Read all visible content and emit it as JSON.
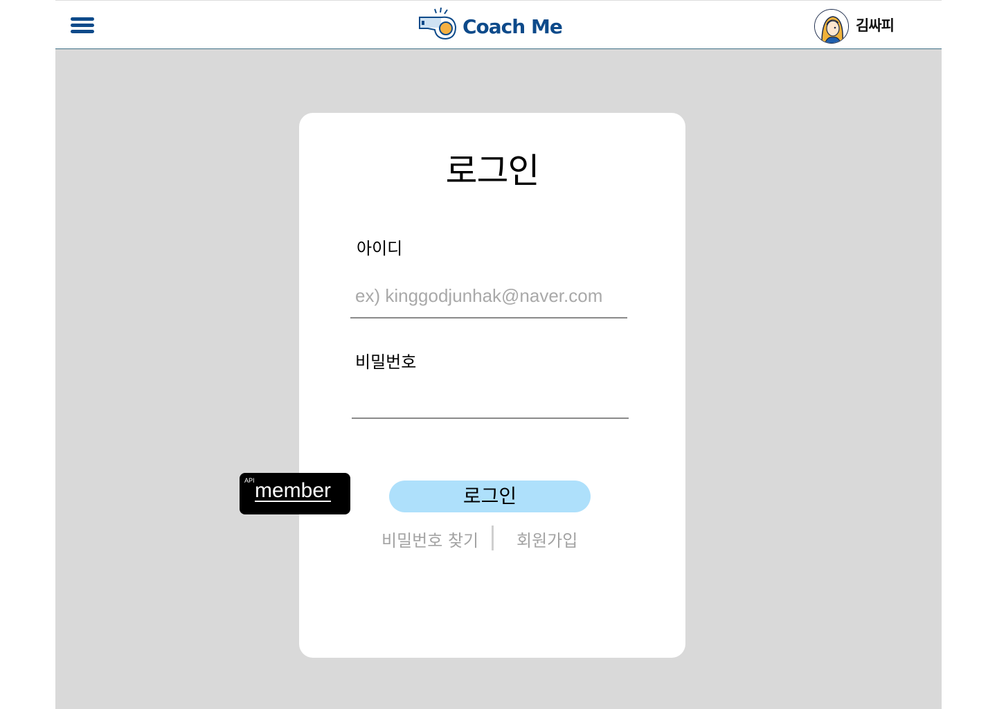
{
  "header": {
    "logo_text": "Coach Me",
    "user_name": "김싸피"
  },
  "login": {
    "title": "로그인",
    "id_label": "아이디",
    "id_placeholder": "ex) kinggodjunhak@naver.com",
    "id_value": "",
    "password_label": "비밀번호",
    "password_value": "",
    "submit_label": "로그인",
    "find_password_label": "비밀번호 찾기",
    "signup_label": "회원가입"
  },
  "api_badge": {
    "tag": "API",
    "name": "member"
  },
  "colors": {
    "brand": "#0d4a8a",
    "button": "#aee0fb",
    "background": "#d9d9d9",
    "link": "#a3a3a3"
  },
  "icons": {
    "menu": "hamburger-icon",
    "logo": "whistle-icon",
    "avatar": "user-avatar-icon"
  }
}
